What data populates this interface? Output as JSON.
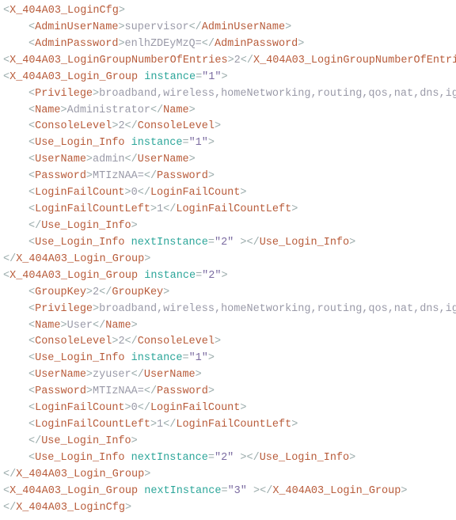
{
  "x": {
    "cfg_open": "X_404A03_LoginCfg",
    "admin_user_tag": "AdminUserName",
    "admin_user_val": "supervisor",
    "admin_pass_tag": "AdminPassword",
    "admin_pass_val": "enlhZDEyMzQ=",
    "entries_tag": "X_404A03_LoginGroupNumberOfEntries",
    "entries_val": "2",
    "group_tag": "X_404A03_Login_Group",
    "attr_instance": "instance",
    "attr_nextinstance": "nextInstance",
    "g1": {
      "instance": "\"1\"",
      "privilege_tag": "Privilege",
      "privilege_val": "broadband,wireless,homeNetworking,routing,qos,nat,dns,igmpS",
      "name_tag": "Name",
      "name_val": "Administrator",
      "console_tag": "ConsoleLevel",
      "console_val": "2",
      "uli_tag": "Use_Login_Info",
      "uli_instance": "\"1\"",
      "user_tag": "UserName",
      "user_val": "admin",
      "pass_tag": "Password",
      "pass_val": "MTIzNAA=",
      "lfc_tag": "LoginFailCount",
      "lfc_val": "0",
      "lfcl_tag": "LoginFailCountLeft",
      "lfcl_val": "1",
      "uli_next": "\"2\""
    },
    "g2": {
      "instance": "\"2\"",
      "gk_tag": "GroupKey",
      "gk_val": "2",
      "privilege_tag": "Privilege",
      "privilege_val": "broadband,wireless,homeNetworking,routing,qos,nat,dns,igmpS",
      "name_tag": "Name",
      "name_val": "User",
      "console_tag": "ConsoleLevel",
      "console_val": "2",
      "uli_tag": "Use_Login_Info",
      "uli_instance": "\"1\"",
      "user_tag": "UserName",
      "user_val": "zyuser",
      "pass_tag": "Password",
      "pass_val": "MTIzNAA=",
      "lfc_tag": "LoginFailCount",
      "lfc_val": "0",
      "lfcl_tag": "LoginFailCountLeft",
      "lfcl_val": "1",
      "uli_next": "\"2\""
    },
    "g3_next": "\"3\""
  }
}
